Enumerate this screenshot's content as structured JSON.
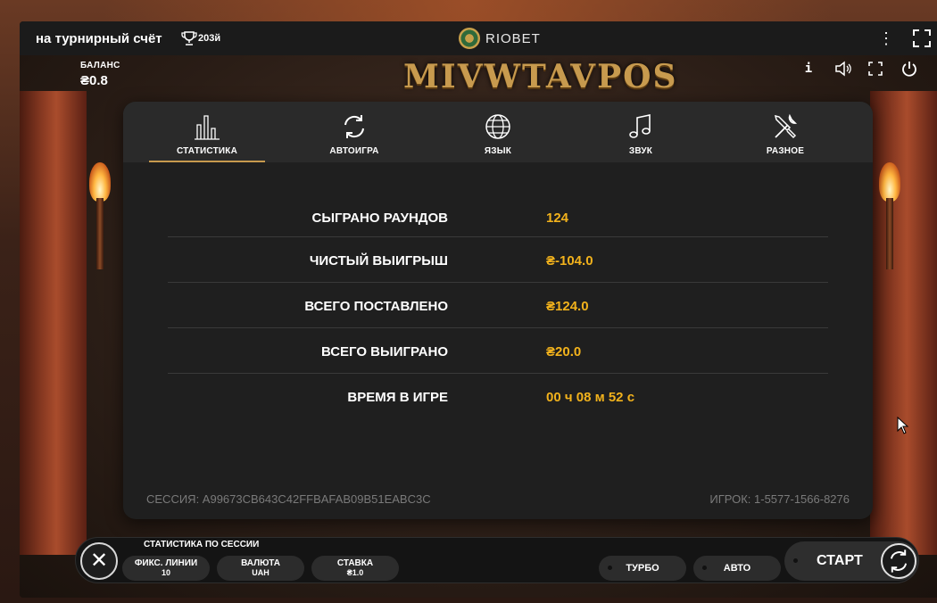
{
  "topbar": {
    "tournament_label": "на турнирный счёт",
    "trophy_count": "203й",
    "brand_name": "RIOBET",
    "menu_icon": "more-vertical-icon",
    "fullscreen_icon": "fullscreen-icon"
  },
  "game": {
    "balance_label": "БАЛАНС",
    "balance_value": "₴0.8",
    "logo_text": "MIVWTAVPOS",
    "info_icon_glyph": "i"
  },
  "tabs": [
    {
      "label": "СТАТИСТИКА",
      "icon": "bar-chart-icon",
      "active": true
    },
    {
      "label": "АВТОИГРА",
      "icon": "refresh-icon",
      "active": false
    },
    {
      "label": "ЯЗЫК",
      "icon": "globe-icon",
      "active": false
    },
    {
      "label": "ЗВУК",
      "icon": "music-note-icon",
      "active": false
    },
    {
      "label": "РАЗНОЕ",
      "icon": "tools-icon",
      "active": false
    }
  ],
  "stats": [
    {
      "key": "СЫГРАНО РАУНДОВ",
      "value": "124"
    },
    {
      "key": "ЧИСТЫЙ ВЫИГРЫШ",
      "value": "₴-104.0"
    },
    {
      "key": "ВСЕГО ПОСТАВЛЕНО",
      "value": "₴124.0"
    },
    {
      "key": "ВСЕГО ВЫИГРАНО",
      "value": "₴20.0"
    },
    {
      "key": "ВРЕМЯ В ИГРЕ",
      "value": "00 ч 08 м 52 с"
    }
  ],
  "footer": {
    "session": "СЕССИЯ: A99673CB643C42FFBAFAB09B51EABC3C",
    "player": "ИГРОК: 1-5577-1566-8276"
  },
  "bottombar": {
    "close_glyph": "✕",
    "session_stats_label": "СТАТИСТИКА ПО СЕССИИ",
    "lines": {
      "label": "ФИКС. ЛИНИИ",
      "value": "10"
    },
    "currency": {
      "label": "ВАЛЮТА",
      "value": "UAH"
    },
    "bet": {
      "label": "СТАВКА",
      "value": "₴1.0"
    },
    "turbo_label": "ТУРБО",
    "auto_label": "АВТО",
    "start_label": "СТАРТ"
  },
  "colors": {
    "accent_gold": "#c79a4e",
    "value_yellow": "#f2b21c",
    "panel_bg": "#1f1f1f"
  }
}
